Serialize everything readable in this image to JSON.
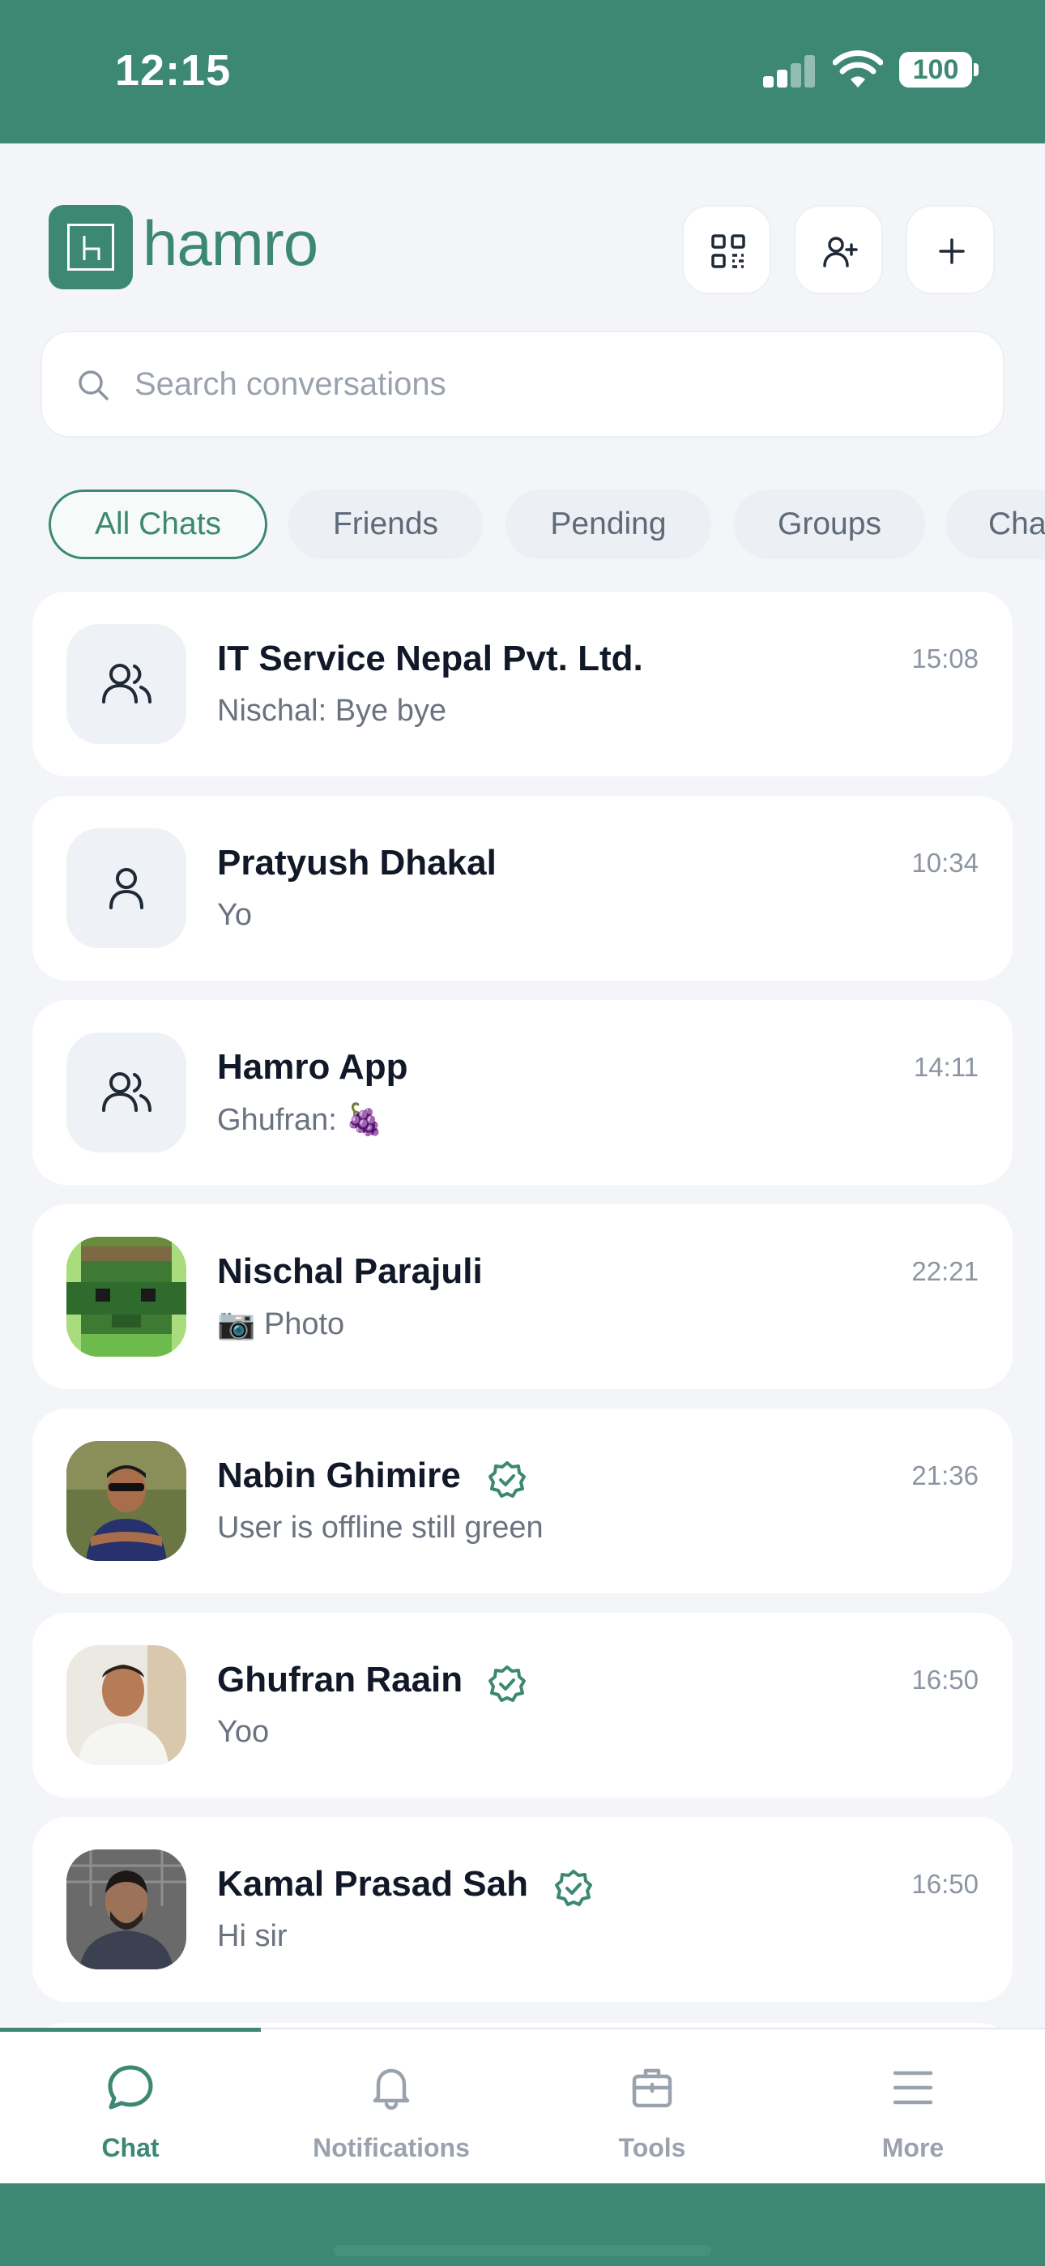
{
  "status_bar": {
    "time": "12:15",
    "battery": "100"
  },
  "header": {
    "brand": "hamro",
    "buttons": [
      {
        "name": "qr-code-button",
        "icon": "qr-code-icon"
      },
      {
        "name": "add-friend-button",
        "icon": "user-plus-icon"
      },
      {
        "name": "new-chat-button",
        "icon": "plus-icon"
      }
    ]
  },
  "search": {
    "placeholder": "Search conversations",
    "value": ""
  },
  "tabs": [
    {
      "label": "All Chats",
      "active": true
    },
    {
      "label": "Friends",
      "active": false
    },
    {
      "label": "Pending",
      "active": false
    },
    {
      "label": "Groups",
      "active": false
    },
    {
      "label": "Cha",
      "active": false
    }
  ],
  "chats": [
    {
      "name": "IT Service Nepal Pvt. Ltd.",
      "preview": "Nischal: Bye bye",
      "time": "15:08",
      "avatar": "group-icon",
      "verified": false
    },
    {
      "name": "Pratyush Dhakal",
      "preview": "Yo",
      "time": "10:34",
      "avatar": "user-icon",
      "verified": false
    },
    {
      "name": "Hamro App",
      "preview": "Ghufran: 🍇",
      "time": "14:11",
      "avatar": "group-icon",
      "verified": false
    },
    {
      "name": "Nischal Parajuli",
      "preview": "📷 Photo",
      "time": "22:21",
      "avatar": "pixel-art-avatar",
      "verified": false
    },
    {
      "name": "Nabin Ghimire",
      "preview": "User is offline still green",
      "time": "21:36",
      "avatar": "photo-avatar",
      "verified": true
    },
    {
      "name": "Ghufran Raain",
      "preview": "Yoo",
      "time": "16:50",
      "avatar": "photo-avatar",
      "verified": true
    },
    {
      "name": "Kamal Prasad Sah",
      "preview": "Hi sir",
      "time": "16:50",
      "avatar": "photo-avatar",
      "verified": true
    }
  ],
  "bottom_nav": [
    {
      "label": "Chat",
      "icon": "chat-bubble-icon",
      "active": true
    },
    {
      "label": "Notifications",
      "icon": "bell-icon",
      "active": false
    },
    {
      "label": "Tools",
      "icon": "toolbox-icon",
      "active": false
    },
    {
      "label": "More",
      "icon": "menu-icon",
      "active": false
    }
  ],
  "colors": {
    "brand": "#3d8873",
    "background": "#f3f5f8",
    "card": "#ffffff",
    "muted_text": "#6b7380"
  }
}
